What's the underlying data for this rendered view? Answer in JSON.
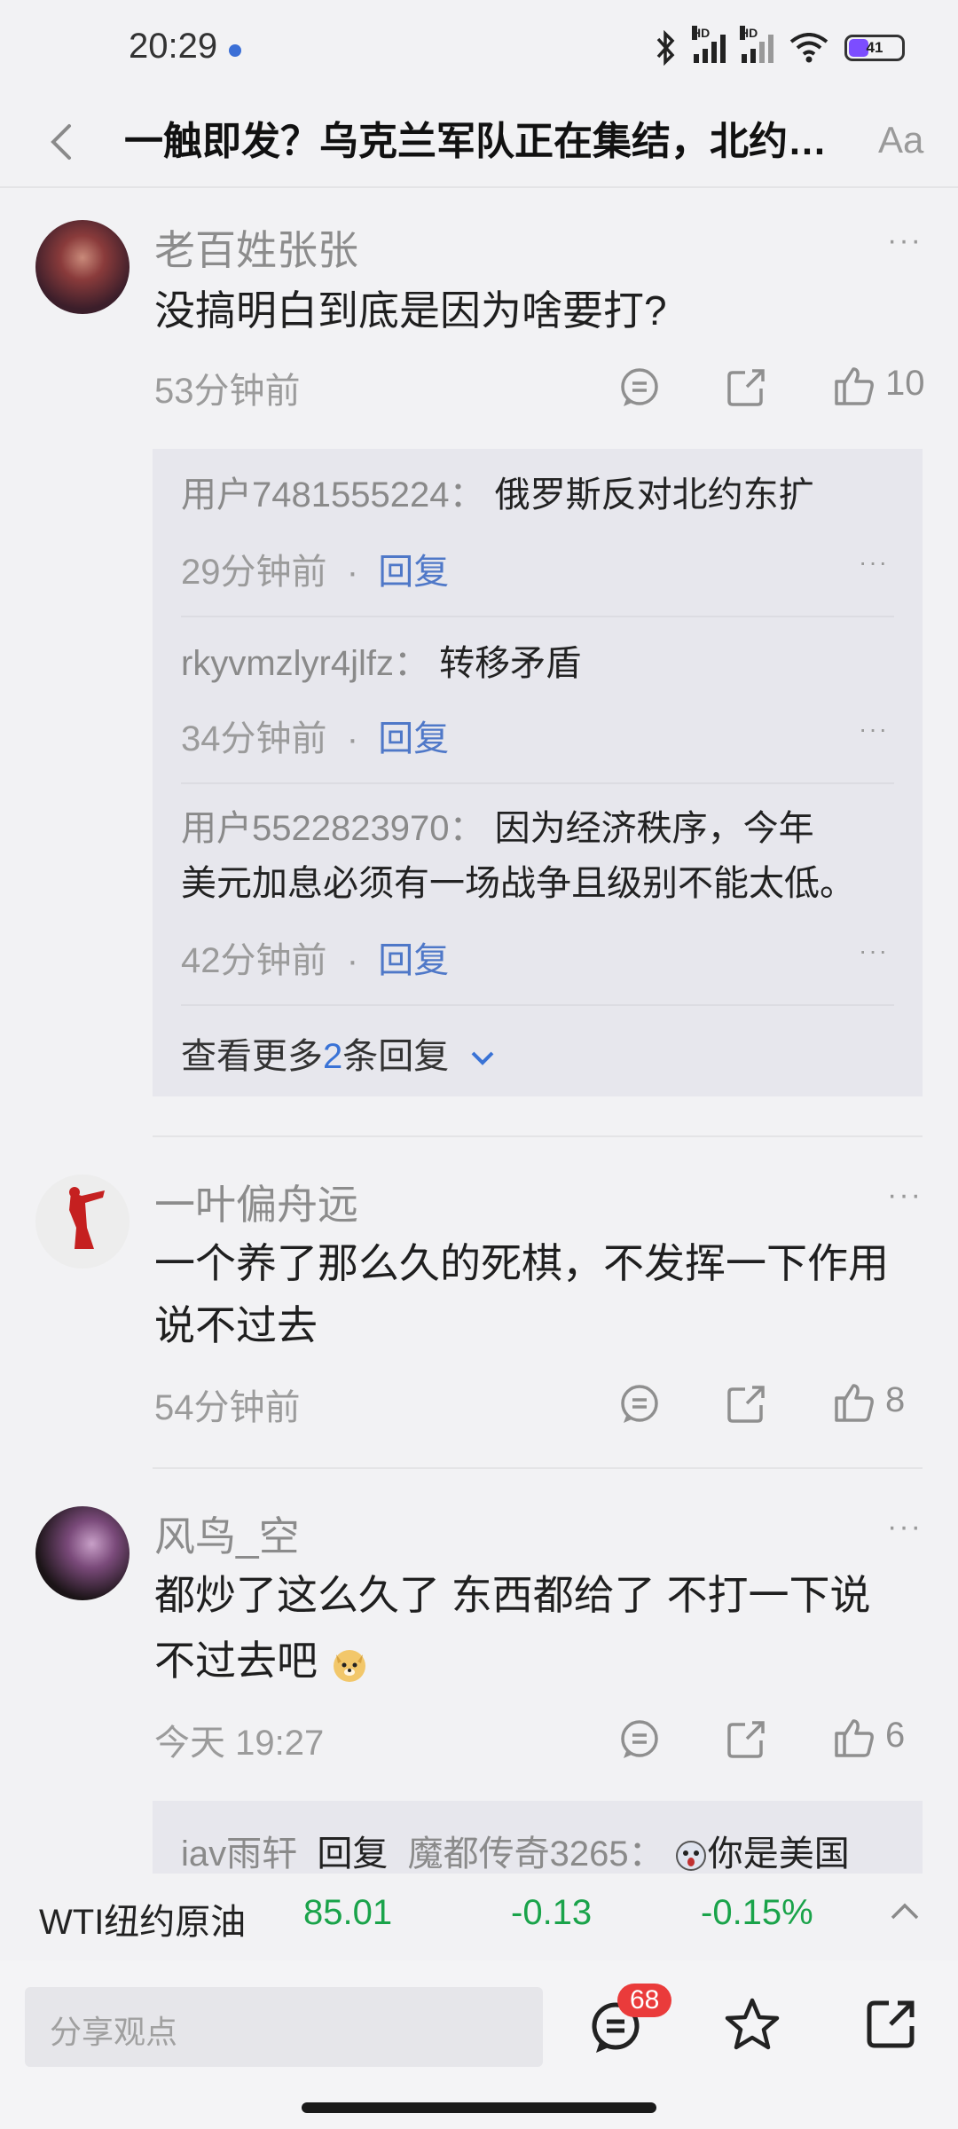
{
  "status_bar": {
    "time": "20:29",
    "battery": "41",
    "hd1": "HD",
    "hd2": "HD"
  },
  "header": {
    "title": "一触即发？乌克兰军队正在集结，北约…",
    "font_button": "Aa"
  },
  "comments": [
    {
      "name": "老百姓张张",
      "text_lines": [
        "没搞明白到底是因为啥要打?"
      ],
      "time": "53分钟前",
      "likes": "10",
      "replies": [
        {
          "user": "用户7481555224：",
          "text_lines": [
            "俄罗斯反对北约东扩"
          ],
          "time": "29分钟前",
          "reply_label": "回复"
        },
        {
          "user": "rkyvmzlyr4jlfz：",
          "text_lines": [
            "转移矛盾"
          ],
          "time": "34分钟前",
          "reply_label": "回复"
        },
        {
          "user": "用户5522823970：",
          "text_lines": [
            "因为经济秩序，今年",
            "美元加息必须有一场战争且级别不能太低。"
          ],
          "time": "42分钟前",
          "reply_label": "回复"
        }
      ],
      "more_replies": {
        "prefix": "查看更多",
        "count": "2",
        "suffix": "条回复"
      }
    },
    {
      "name": "一叶偏舟远",
      "text_lines": [
        "一个养了那么久的死棋，不发挥一下作用",
        "说不过去"
      ],
      "time": "54分钟前",
      "likes": "8"
    },
    {
      "name": "风鸟_空",
      "text_lines": [
        "都炒了这么久了 东西都给了  不打一下说",
        "不过去吧"
      ],
      "time": "今天 19:27",
      "likes": "6",
      "partial_reply": {
        "user": "iav雨轩",
        "reply_word": "回复",
        "target": "魔都传奇3265：",
        "text": "你是美国"
      }
    }
  ],
  "ticker": {
    "name": "WTI纽约原油",
    "price": "85.01",
    "change": "-0.13",
    "percent": "-0.15%"
  },
  "bottom_bar": {
    "placeholder": "分享观点",
    "comment_count": "68"
  },
  "colors": {
    "up_green": "#1aa34a",
    "reply_blue": "#4f78c8",
    "badge_red": "#ea3b3b"
  }
}
